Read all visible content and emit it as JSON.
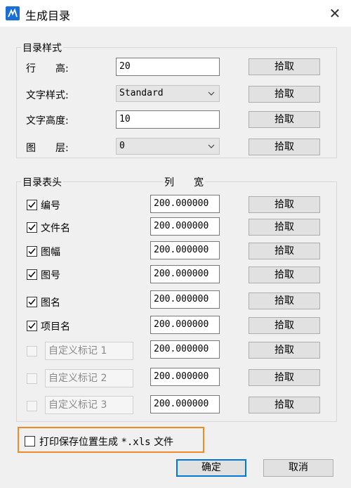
{
  "window": {
    "title": "生成目录",
    "close_glyph": "✕"
  },
  "style_group": {
    "title": "目录样式",
    "row_height": {
      "label": "行　　高:",
      "value": "20",
      "pick": "拾取"
    },
    "text_style": {
      "label": "文字样式:",
      "value": "Standard",
      "pick": "拾取"
    },
    "text_height": {
      "label": "文字高度:",
      "value": "10",
      "pick": "拾取"
    },
    "layer": {
      "label": "图　　层:",
      "value": "0",
      "pick": "拾取"
    }
  },
  "header_group": {
    "title": "目录表头",
    "col_width_label": "列　　宽",
    "rows": [
      {
        "label": "编号",
        "checked": true,
        "width": "200.000000",
        "pick": "拾取"
      },
      {
        "label": "文件名",
        "checked": true,
        "width": "200.000000",
        "pick": "拾取"
      },
      {
        "label": "图幅",
        "checked": true,
        "width": "200.000000",
        "pick": "拾取"
      },
      {
        "label": "图号",
        "checked": true,
        "width": "200.000000",
        "pick": "拾取"
      },
      {
        "label": "图名",
        "checked": true,
        "width": "200.000000",
        "pick": "拾取"
      },
      {
        "label": "项目名",
        "checked": true,
        "width": "200.000000",
        "pick": "拾取"
      },
      {
        "label": "自定义标记 1",
        "checked": false,
        "width": "200.000000",
        "pick": "拾取"
      },
      {
        "label": "自定义标记 2",
        "checked": false,
        "width": "200.000000",
        "pick": "拾取"
      },
      {
        "label": "自定义标记 3",
        "checked": false,
        "width": "200.000000",
        "pick": "拾取"
      }
    ]
  },
  "print_option": {
    "prefix": "打印保存位置生成",
    "ext": "*.xls",
    "suffix": "文件",
    "checked": false
  },
  "actions": {
    "ok": "确定",
    "cancel": "取消"
  },
  "colors": {
    "highlight": "#f08a24",
    "focus": "#0078d7"
  }
}
